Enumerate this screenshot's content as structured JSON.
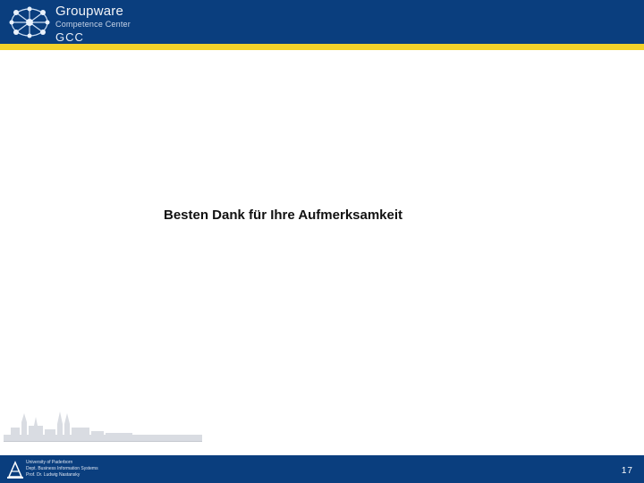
{
  "header": {
    "brand_line1": "Groupware",
    "brand_line2": "Competence Center",
    "brand_line3": "GCC"
  },
  "slide": {
    "message": "Besten Dank für Ihre Aufmerksamkeit"
  },
  "footer": {
    "university": "University of Paderborn",
    "department": "Dept. Business Information Systems",
    "professor": "Prof. Dr. Ludwig Nastansky",
    "page_number": "17"
  },
  "colors": {
    "header_blue": "#0a3e7e",
    "accent_yellow": "#f3d22a"
  }
}
